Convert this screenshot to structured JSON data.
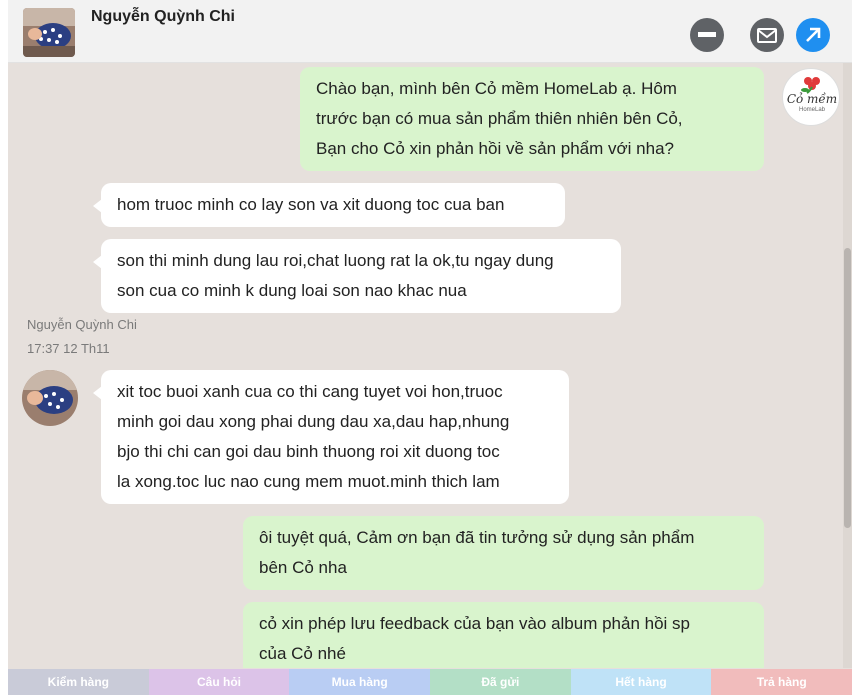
{
  "header": {
    "contact_name": "Nguyễn Quỳnh Chi",
    "icons": [
      "minimize-icon",
      "mail-icon",
      "open-external-icon"
    ]
  },
  "brand": {
    "line1": "Cỏ mềm",
    "line2": "HomeLab"
  },
  "messages": [
    {
      "direction": "outgoing",
      "lines": [
        "Chào bạn, mình bên Cỏ mềm HomeLab ạ. Hôm",
        "trước bạn có mua sản phẩm thiên nhiên bên Cỏ,",
        "Bạn cho Cỏ xin phản hồi về sản phẩm với nha?"
      ]
    },
    {
      "direction": "incoming",
      "lines": [
        "hom truoc minh co lay son va xit duong toc cua ban"
      ]
    },
    {
      "direction": "incoming",
      "lines": [
        "son thi minh dung lau roi,chat luong rat la ok,tu ngay dung",
        "son cua co minh k dung loai son nao khac nua"
      ]
    },
    {
      "direction": "incoming",
      "lines": [
        "xit toc buoi xanh cua co thi cang tuyet voi hon,truoc",
        "minh goi dau xong phai dung dau xa,dau hap,nhung",
        "bjo thi chi can goi dau binh thuong roi xit duong toc",
        "la xong.toc luc nao cung mem muot.minh thich lam"
      ]
    },
    {
      "direction": "outgoing",
      "lines": [
        "ôi tuyệt quá, Cảm ơn bạn đã tin tưởng sử dụng sản phẩm",
        "bên Cỏ nha"
      ]
    },
    {
      "direction": "outgoing",
      "lines": [
        "cỏ xin phép lưu feedback của bạn vào album phản hồi sp",
        "của Cỏ nhé"
      ]
    }
  ],
  "sender_meta": {
    "name": "Nguyễn Quỳnh Chi",
    "time": "17:37 12 Th11"
  },
  "tags": [
    {
      "label": "Kiểm hàng",
      "color": "#c9cbd8"
    },
    {
      "label": "Câu hỏi",
      "color": "#dcc3e8"
    },
    {
      "label": "Mua hàng",
      "color": "#b9cdf3"
    },
    {
      "label": "Đã gửi",
      "color": "#b3dfc6"
    },
    {
      "label": "Hết hàng",
      "color": "#bfe2f7"
    },
    {
      "label": "Trả hàng",
      "color": "#f1bcbc"
    }
  ],
  "colors": {
    "outgoing_bubble": "#d9f4cd",
    "incoming_bubble": "#ffffff",
    "chat_bg": "#e6e0dc",
    "accent": "#1f8ff0"
  }
}
